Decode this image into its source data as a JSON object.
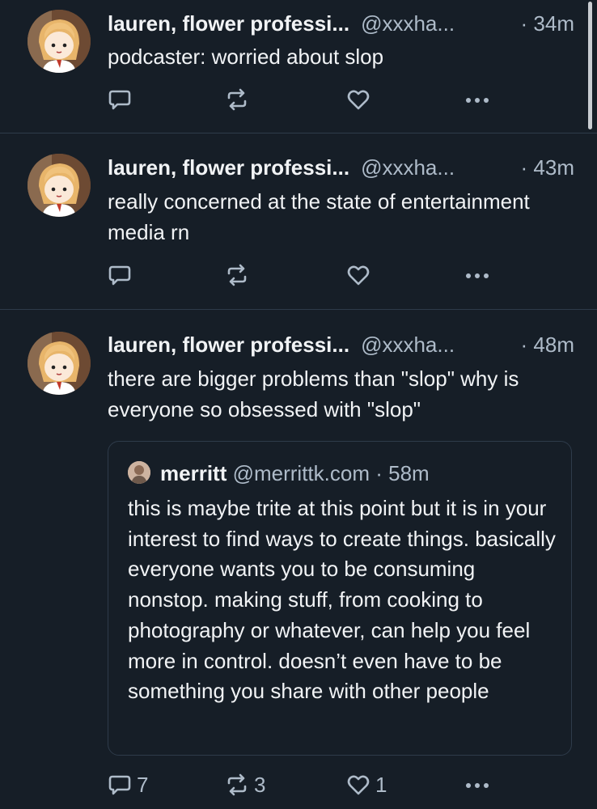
{
  "posts": [
    {
      "author_name": "lauren, flower professi...",
      "handle": "@xxxha...",
      "time": "· 34m",
      "text": "podcaster: worried about slop",
      "counts": {
        "reply": "",
        "repost": "",
        "like": ""
      }
    },
    {
      "author_name": "lauren, flower professi...",
      "handle": "@xxxha...",
      "time": "· 43m",
      "text": "really concerned at the state of entertainment media rn",
      "counts": {
        "reply": "",
        "repost": "",
        "like": ""
      }
    },
    {
      "author_name": "lauren, flower professi...",
      "handle": "@xxxha...",
      "time": "· 48m",
      "text": "there are bigger problems than \"slop\" why is everyone so obsessed with \"slop\"",
      "quote": {
        "author_name": "merritt",
        "handle": "@merrittk.com",
        "time": "· 58m",
        "text": "this is maybe trite at this point but it is in your interest to find ways to create things. basically everyone wants you to be consuming nonstop. making stuff, from cooking to photography or whatever, can help you feel more in control. doesn’t even have to be something you share with other people"
      },
      "counts": {
        "reply": "7",
        "repost": "3",
        "like": "1"
      }
    }
  ],
  "icons": {
    "reply": "reply-icon",
    "repost": "repost-icon",
    "like": "heart-icon",
    "more": "more-icon"
  },
  "colors": {
    "background": "#161e27",
    "text": "#f1f3f5",
    "muted": "#aebbc9",
    "divider": "#2e3b4a"
  }
}
